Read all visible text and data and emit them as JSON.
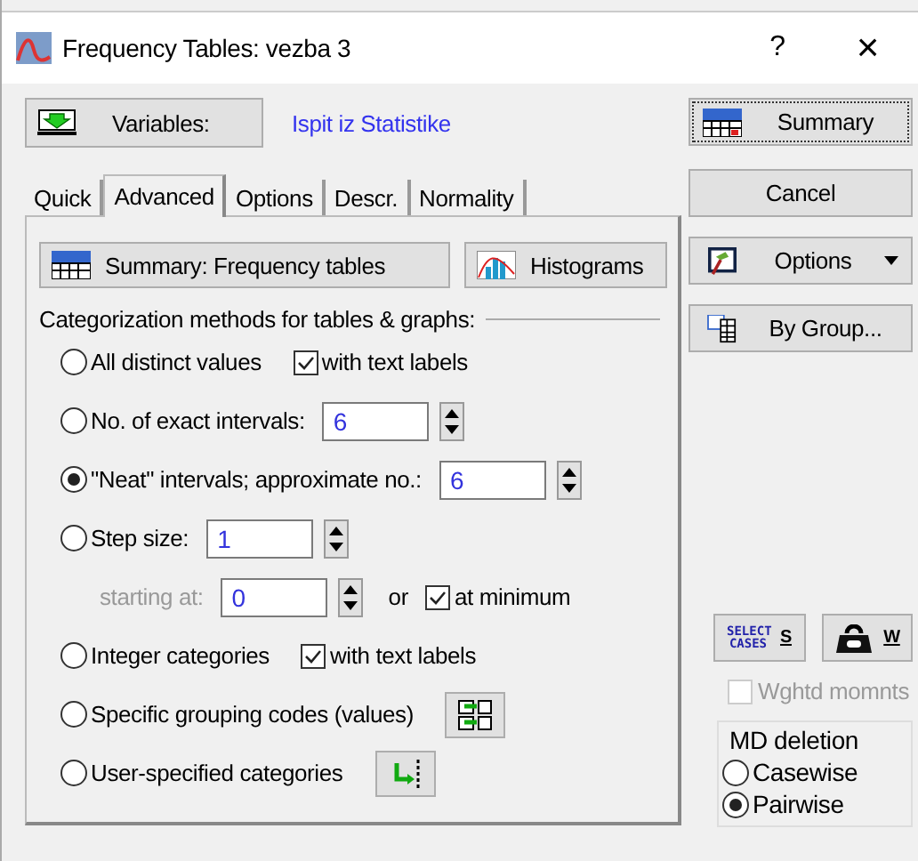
{
  "window": {
    "title": "Frequency Tables: vezba 3",
    "help": "?",
    "close": "×"
  },
  "variables": {
    "button": "Variables:",
    "value": "Ispit iz Statistike"
  },
  "tabs": [
    {
      "label": "Quick",
      "selected": false
    },
    {
      "label": "Advanced",
      "selected": true
    },
    {
      "label": "Options",
      "selected": false
    },
    {
      "label": "Descr.",
      "selected": false
    },
    {
      "label": "Normality",
      "selected": false
    }
  ],
  "panel_buttons": [
    {
      "kind": "summary",
      "label": "Summary:  Frequency tables"
    },
    {
      "kind": "histogram",
      "label": "Histograms"
    }
  ],
  "group_label": "Categorization methods for tables & graphs:",
  "methods": [
    {
      "kind": "check",
      "label": "All distinct values",
      "selected": false,
      "checkbox": {
        "label": "with text labels",
        "checked": true
      }
    },
    {
      "kind": "spin",
      "label": "No. of exact intervals:",
      "selected": false,
      "value": "6"
    },
    {
      "kind": "spin",
      "label": "\"Neat\" intervals; approximate no.:",
      "selected": true,
      "value": "6"
    },
    {
      "kind": "step",
      "label": "Step size:",
      "selected": false,
      "value": "1",
      "start_label": "starting at:",
      "start_value": "0",
      "or": "or",
      "checkbox": {
        "label": "at minimum",
        "checked": true
      }
    },
    {
      "kind": "check",
      "label": "Integer categories",
      "selected": false,
      "checkbox": {
        "label": "with text labels",
        "checked": true
      }
    },
    {
      "kind": "codes",
      "label": "Specific grouping codes (values)",
      "selected": false
    },
    {
      "kind": "user",
      "label": "User-specified categories",
      "selected": false
    }
  ],
  "side_buttons": [
    {
      "kind": "summary",
      "label": "Summary",
      "focused": true
    },
    {
      "kind": "plain",
      "label": "Cancel",
      "focused": false
    },
    {
      "kind": "options",
      "label": "Options",
      "focused": false
    },
    {
      "kind": "bygroup",
      "label": "By Group...",
      "focused": false
    }
  ],
  "select_cases": {
    "label": "SELECT CASES",
    "key": "S"
  },
  "weight": {
    "key": "W"
  },
  "weighted_moments": {
    "label": "Wghtd momnts",
    "checked": false,
    "disabled": true
  },
  "md_deletion": {
    "title": "MD deletion",
    "options": [
      {
        "label": "Casewise",
        "selected": false
      },
      {
        "label": "Pairwise",
        "selected": true
      }
    ]
  }
}
